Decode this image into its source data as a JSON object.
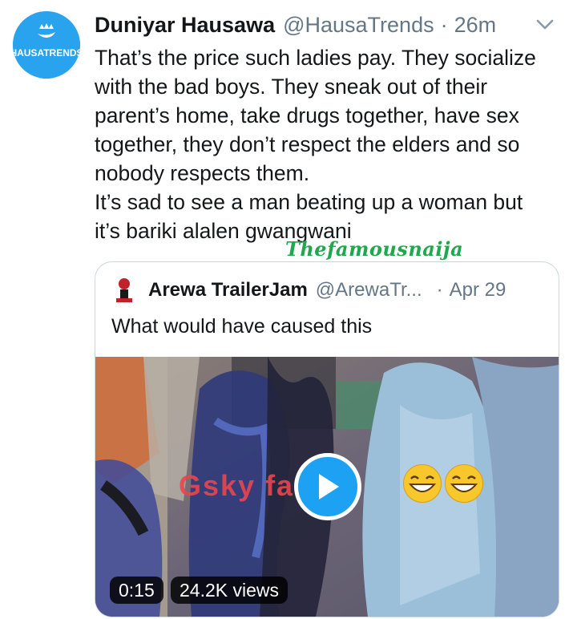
{
  "tweet": {
    "avatar_text": "HAUSATRENDS",
    "display_name": "Duniyar Hausawa",
    "handle": "@HausaTrends",
    "separator": "·",
    "time": "26m",
    "menu_icon": "chevron-down-icon",
    "text_lines": [
      "That’s the price such ladies pay. They socialize",
      "with the bad boys. They sneak out of their",
      "parent’s home, take drugs together, have sex",
      "together, they don’t respect the elders and so",
      "nobody respects them.",
      "It’s sad to see a man beating up a woman but",
      "it’s bariki alalen gwangwani"
    ]
  },
  "watermark": "Thefamousnaija",
  "quoted_tweet": {
    "display_name": "Arewa TrailerJam",
    "handle": "@ArewaTr...",
    "separator": "·",
    "time": "Apr 29",
    "text": "What would have caused this",
    "video": {
      "overlay_text": "Gsky fa  u",
      "play_icon": "play-icon",
      "duration": "0:15",
      "views": "24.2K views"
    }
  },
  "colors": {
    "accent": "#1da1f2",
    "text_primary": "#14171a",
    "text_secondary": "#657786",
    "border": "#ccd6dd",
    "watermark": "#1fa84d"
  }
}
